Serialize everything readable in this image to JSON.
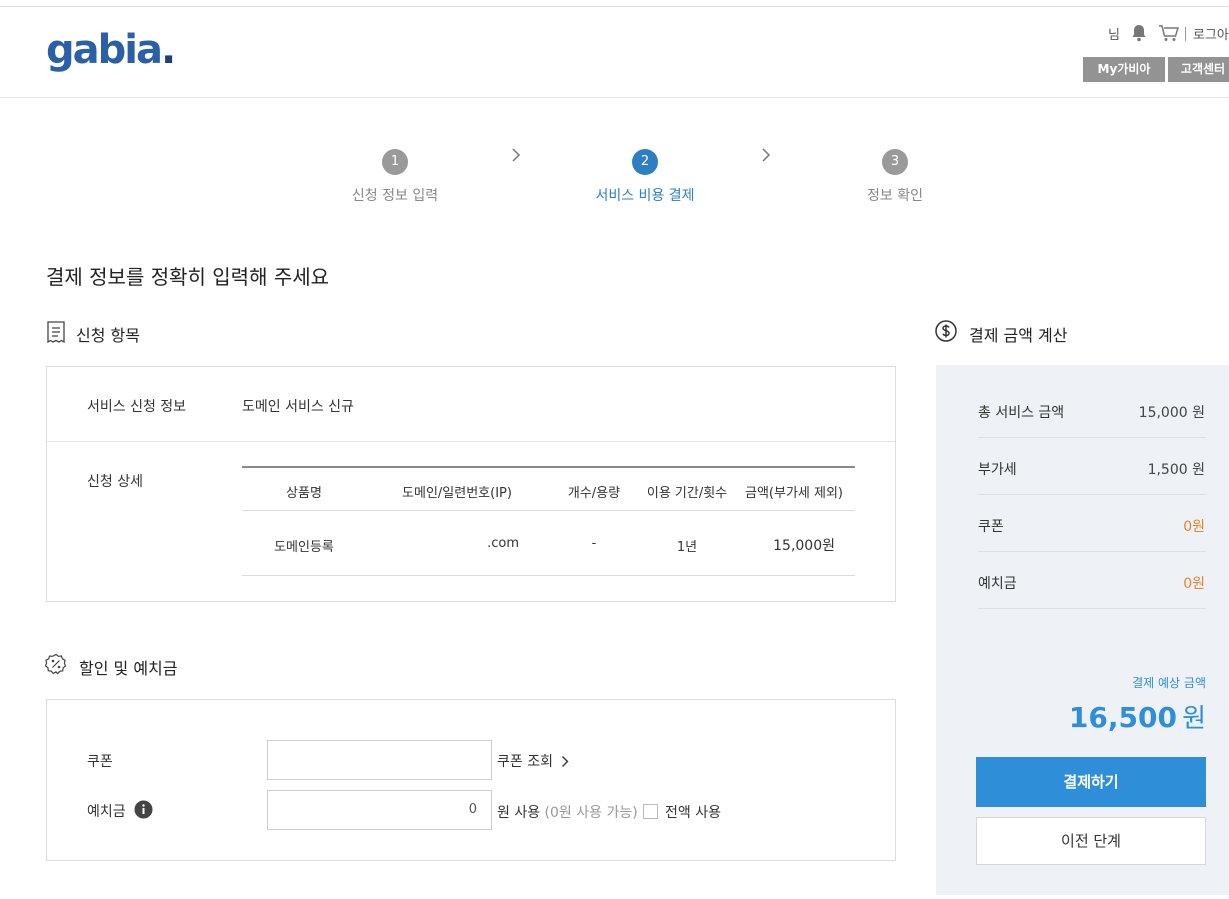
{
  "header": {
    "logo": "gabia",
    "logo_dot": ".",
    "user_suffix": "님",
    "login_label": "로그아",
    "my_gabia": "My가비아",
    "support": "고객센터"
  },
  "steps": [
    {
      "num": "1",
      "label": "신청 정보 입력"
    },
    {
      "num": "2",
      "label": "서비스 비용 결제"
    },
    {
      "num": "3",
      "label": "정보 확인"
    }
  ],
  "page_title": "결제 정보를 정확히 입력해 주세요",
  "application": {
    "section_title": "신청 항목",
    "service_info_label": "서비스 신청 정보",
    "service_info_value": "도메인 서비스 신규",
    "detail_label": "신청 상세",
    "table": {
      "headers": [
        "상품명",
        "도메인/일련번호(IP)",
        "개수/용량",
        "이용 기간/횟수",
        "금액(부가세 제외)"
      ],
      "row": [
        "도메인등록",
        ".com",
        "-",
        "1년",
        "15,000원"
      ]
    }
  },
  "discount": {
    "section_title": "할인 및 예치금",
    "coupon_label": "쿠폰",
    "coupon_lookup": "쿠폰 조회",
    "deposit_label": "예치금",
    "deposit_value": "0",
    "won_use": "원 사용",
    "available": "(0원 사용 가능)",
    "use_all": "전액 사용"
  },
  "calc": {
    "section_title": "결제 금액 계산",
    "rows": [
      {
        "label": "총 서비스 금액",
        "value": "15,000 원"
      },
      {
        "label": "부가세",
        "value": "1,500 원"
      },
      {
        "label": "쿠폰",
        "value": "0원"
      },
      {
        "label": "예치금",
        "value": "0원"
      }
    ],
    "expected_label": "결제 예상 금액",
    "expected_value": "16,500",
    "expected_unit": "원",
    "pay_button": "결제하기",
    "prev_button": "이전 단계"
  },
  "colors": {
    "accent": "#2e8fd8",
    "orange": "#e8842c",
    "step_inactive": "#999999"
  }
}
